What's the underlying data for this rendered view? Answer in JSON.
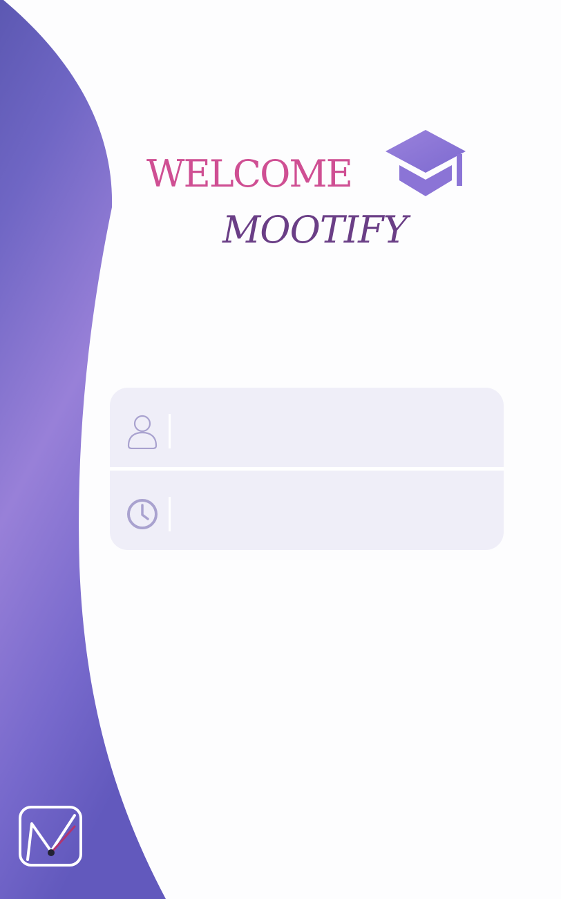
{
  "header": {
    "welcome": "WELCOME",
    "app_name": "MOOTIFY"
  },
  "login_form": {
    "username": {
      "icon": "user-icon",
      "value": "",
      "placeholder": ""
    },
    "password": {
      "icon": "clock-icon",
      "value": "",
      "placeholder": ""
    }
  },
  "icons": {
    "graduation_cap": "graduation-cap-icon",
    "brand_logo": "mootify-logo"
  },
  "colors": {
    "welcome_text": "#cf4f93",
    "app_name_text": "#6a3e86",
    "accent_purple": "#8f7ad6",
    "card_background": "#efeef8",
    "field_icon": "#a9a2cf"
  }
}
